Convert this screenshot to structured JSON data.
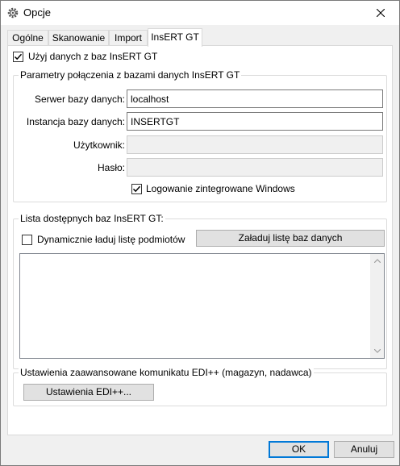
{
  "window": {
    "title": "Opcje"
  },
  "tabs": [
    {
      "label": "Ogólne"
    },
    {
      "label": "Skanowanie"
    },
    {
      "label": "Import"
    },
    {
      "label": "InsERT GT"
    }
  ],
  "insert": {
    "use_db_label": "Użyj danych z baz InsERT GT",
    "use_db_checked": true,
    "connection": {
      "title": "Parametry połączenia z bazami danych InsERT GT",
      "server_label": "Serwer bazy danych:",
      "server_value": "localhost",
      "instance_label": "Instancja bazy danych:",
      "instance_value": "INSERTGT",
      "user_label": "Użytkownik:",
      "user_value": "",
      "password_label": "Hasło:",
      "password_value": "",
      "windows_auth_label": "Logowanie zintegrowane Windows",
      "windows_auth_checked": true
    },
    "db_list": {
      "title": "Lista dostępnych baz InsERT GT:",
      "dynamic_label": "Dynamicznie ładuj listę podmiotów",
      "dynamic_checked": false,
      "load_button": "Załaduj listę baz danych"
    },
    "edi": {
      "title": "Ustawienia zaawansowane komunikatu EDI++ (magazyn, nadawca)",
      "button": "Ustawienia EDI++..."
    }
  },
  "footer": {
    "ok": "OK",
    "cancel": "Anuluj"
  }
}
